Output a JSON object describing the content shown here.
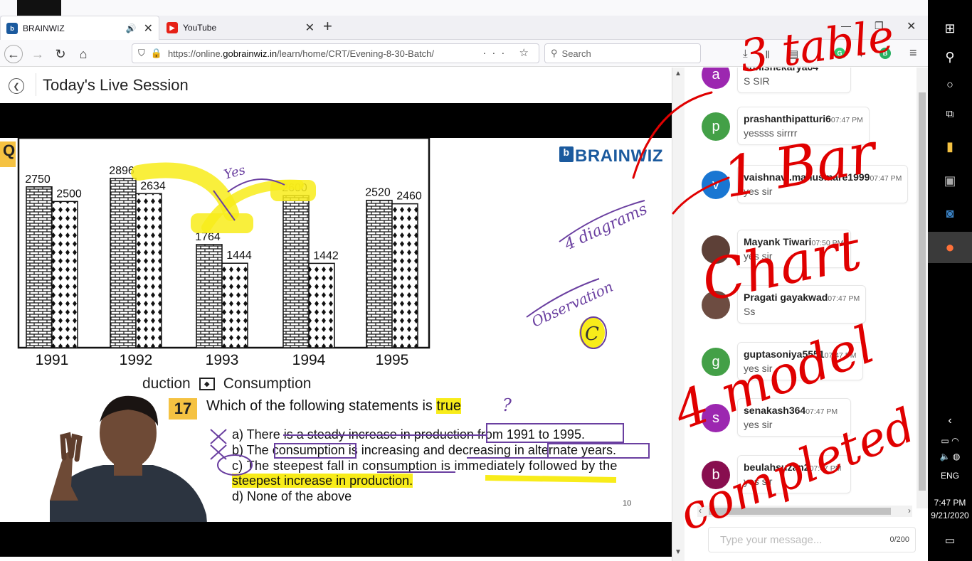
{
  "browser": {
    "tabs": [
      {
        "label": "BRAINWIZ",
        "favicon": "brainwiz-logo-icon",
        "active": true
      },
      {
        "label": "YouTube",
        "favicon": "youtube-icon",
        "active": false
      }
    ],
    "url_prefix": "https://online.",
    "url_domain": "gobrainwiz.in",
    "url_path": "/learn/home/CRT/Evening-8-30-Batch/",
    "search_placeholder": "Search"
  },
  "page": {
    "title": "Today's Live Session"
  },
  "slide": {
    "brand": "BRAINWIZ",
    "q_tag": "Q",
    "legend_partial": "duction",
    "legend_consumption": "Consumption",
    "question_number": "17",
    "question_text": "Which of the following statements is",
    "question_highlight": "true",
    "options": [
      "a) There is a steady increase in production from 1991 to 1995.",
      "b) The consumption is increasing and decreasing in alternate years.",
      "c) The steepest fall in consumption is immediately followed by the",
      "steepest increase in production.",
      "d) None of the above"
    ],
    "page_number": "10"
  },
  "chart_data": {
    "type": "bar",
    "categories": [
      "1991",
      "1992",
      "1993",
      "1994",
      "1995"
    ],
    "series": [
      {
        "name": "Production",
        "values": [
          2750,
          2896,
          1764,
          2600,
          2520
        ]
      },
      {
        "name": "Consumption",
        "values": [
          2500,
          2634,
          1444,
          1442,
          2460
        ]
      }
    ],
    "ylim": [
      0,
      3100
    ],
    "grid": false,
    "legend": "bottom"
  },
  "annotations": {
    "yes": "Yes",
    "diagrams": "4 diagrams",
    "observation": "Observation",
    "answer": "C",
    "question_mark": "?"
  },
  "chat": {
    "messages": [
      {
        "avatar_letter": "a",
        "avatar_color": "#9c27b0",
        "name": "abhishekarya64",
        "time": "",
        "text": "S SIR"
      },
      {
        "avatar_letter": "p",
        "avatar_color": "#43a047",
        "name": "prashanthipatturi6",
        "time": "07:47 PM",
        "text": "yessss sirrrr"
      },
      {
        "avatar_letter": "v",
        "avatar_color": "#1976d2",
        "name": "vaishnavi.manusmare1999",
        "time": "07:47 PM",
        "text": "yes sir"
      },
      {
        "avatar_letter": "",
        "avatar_color": "#5d4037",
        "name": "Mayank Tiwari",
        "time": "07:50 PM",
        "text": "yes sir"
      },
      {
        "avatar_letter": "",
        "avatar_color": "#6d4c41",
        "name": "Pragati gayakwad",
        "time": "07:47 PM",
        "text": "Ss"
      },
      {
        "avatar_letter": "g",
        "avatar_color": "#43a047",
        "name": "guptasoniya5551",
        "time": "07:47 PM",
        "text": "yes sir"
      },
      {
        "avatar_letter": "s",
        "avatar_color": "#9c27b0",
        "name": "senakash364",
        "time": "07:47 PM",
        "text": "yes sir"
      },
      {
        "avatar_letter": "b",
        "avatar_color": "#880e4f",
        "name": "beulahsuzan2",
        "time": "07:47 PM",
        "text": "yes sir"
      }
    ],
    "input_placeholder": "Type your message...",
    "char_count": "0/200"
  },
  "ink_text": {
    "line1": "3 table",
    "line2": "1 Bar",
    "line3": "Chart",
    "line4": "4 model",
    "line5": "completed"
  },
  "taskbar": {
    "language": "ENG",
    "time": "7:47 PM",
    "date": "9/21/2020"
  },
  "colors": {
    "brand_blue": "#1b5a9e",
    "highlight_yellow": "#f8ec1a",
    "ink_red": "#e00000",
    "ink_purple": "#6a3fa0"
  }
}
